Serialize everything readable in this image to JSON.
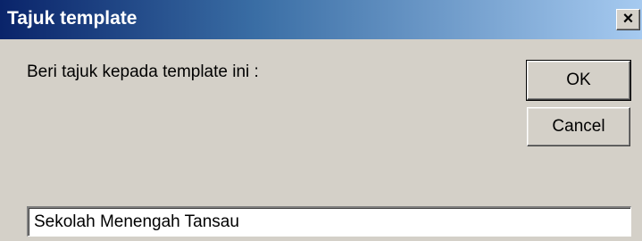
{
  "window": {
    "title": "Tajuk template",
    "close_symbol": "×",
    "close_icon": "close-icon"
  },
  "prompt": {
    "label": "Beri tajuk kepada template ini :"
  },
  "buttons": {
    "ok_label": "OK",
    "cancel_label": "Cancel"
  },
  "input": {
    "value": "Sekolah Menengah Tansau",
    "placeholder": ""
  },
  "colors": {
    "titlebar_start": "#0a246a",
    "titlebar_end": "#a6caf0",
    "dialog_background": "#d4d0c8",
    "input_background": "#ffffff"
  }
}
